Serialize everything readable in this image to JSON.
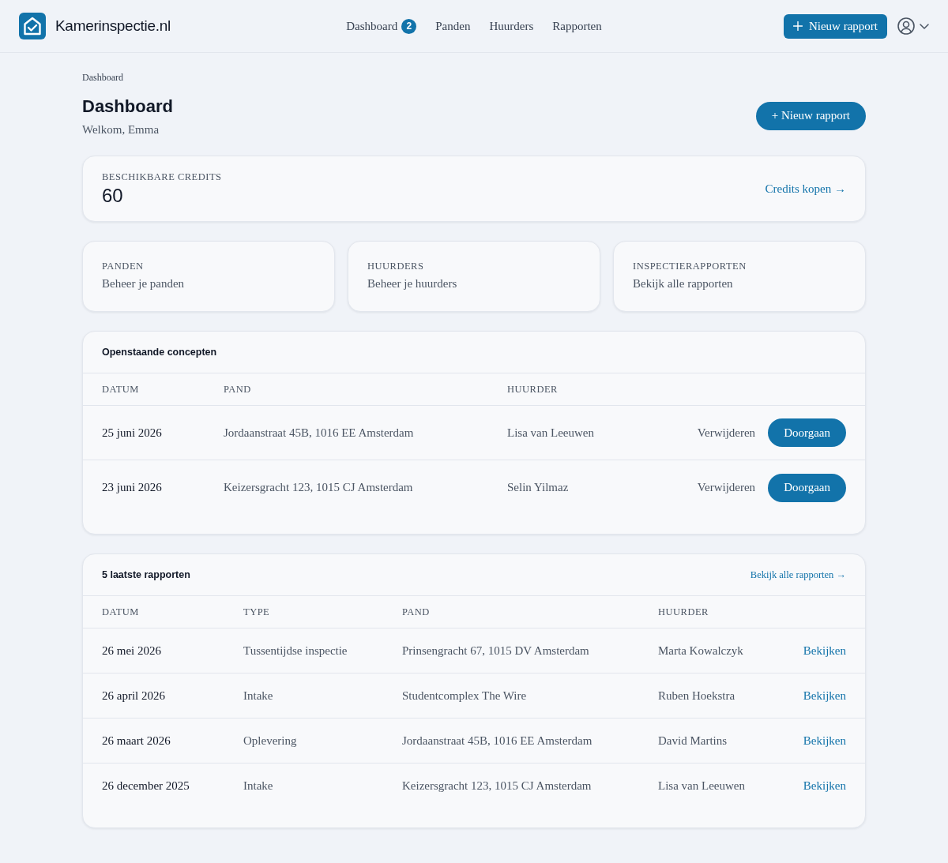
{
  "header": {
    "brand": "Kamerinspectie.nl",
    "nav": [
      {
        "label": "Dashboard",
        "badge": "2"
      },
      {
        "label": "Panden"
      },
      {
        "label": "Huurders"
      },
      {
        "label": "Rapporten"
      }
    ],
    "new_button": "Nieuw rapport"
  },
  "breadcrumb": "Dashboard",
  "title": "Dashboard",
  "subtitle": "Welkom, Emma",
  "new_button": "+ Nieuw rapport",
  "credits": {
    "label": "BESCHIKBARE CREDITS",
    "value": "60",
    "link": "Credits kopen →"
  },
  "tiles": [
    {
      "label": "PANDEN",
      "description": "Beheer je panden"
    },
    {
      "label": "HUURDERS",
      "description": "Beheer je huurders"
    },
    {
      "label": "INSPECTIERAPPORTEN",
      "description": "Bekijk alle rapporten"
    }
  ],
  "concepts": {
    "title": "Openstaande concepten",
    "columns": [
      "DATUM",
      "PAND",
      "HUURDER"
    ],
    "rows": [
      {
        "date": "25 juni 2026",
        "property": "Jordaanstraat 45B, 1016 EE Amsterdam",
        "tenant": "Lisa van Leeuwen",
        "delete": "Verwijderen",
        "continue": "Doorgaan"
      },
      {
        "date": "23 juni 2026",
        "property": "Keizersgracht 123, 1015 CJ Amsterdam",
        "tenant": "Selin Yilmaz",
        "delete": "Verwijderen",
        "continue": "Doorgaan"
      }
    ]
  },
  "reports": {
    "title": "5 laatste rapporten",
    "link": "Bekijk alle rapporten →",
    "columns": [
      "DATUM",
      "TYPE",
      "PAND",
      "HUURDER"
    ],
    "rows": [
      {
        "date": "26 mei 2026",
        "type": "Tussentijdse inspectie",
        "property": "Prinsengracht 67, 1015 DV Amsterdam",
        "tenant": "Marta Kowalczyk",
        "action": "Bekijken"
      },
      {
        "date": "26 april 2026",
        "type": "Intake",
        "property": "Studentcomplex The Wire",
        "tenant": "Ruben Hoekstra",
        "action": "Bekijken"
      },
      {
        "date": "26 maart 2026",
        "type": "Oplevering",
        "property": "Jordaanstraat 45B, 1016 EE Amsterdam",
        "tenant": "David Martins",
        "action": "Bekijken"
      },
      {
        "date": "26 december 2025",
        "type": "Intake",
        "property": "Keizersgracht 123, 1015 CJ Amsterdam",
        "tenant": "Lisa van Leeuwen",
        "action": "Bekijken"
      }
    ]
  }
}
